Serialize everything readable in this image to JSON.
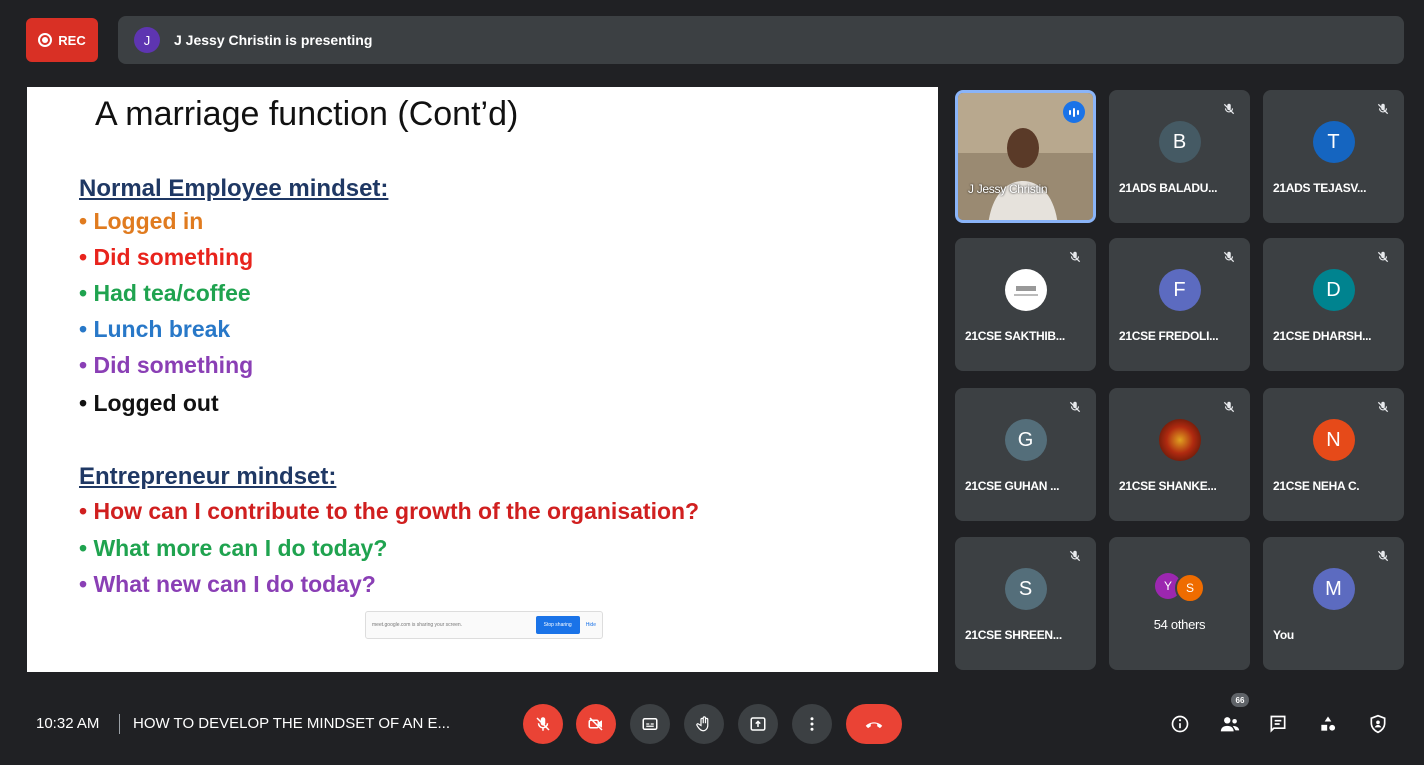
{
  "recording": {
    "label": "REC"
  },
  "presenter": {
    "initial": "J",
    "text": "J Jessy Christin is presenting"
  },
  "slide": {
    "title": "A marriage function (Cont’d)",
    "section1": {
      "heading": "Normal Employee mindset:",
      "items": [
        {
          "text": "Logged in",
          "color": "#e07b1f"
        },
        {
          "text": "Did something",
          "color": "#e8231c"
        },
        {
          "text": "Had tea/coffee",
          "color": "#1fa34f"
        },
        {
          "text": "Lunch break",
          "color": "#2878c8"
        },
        {
          "text": "Did something",
          "color": "#8a3fb5"
        },
        {
          "text": "Logged out",
          "color": "#111111"
        }
      ]
    },
    "section2": {
      "heading": "Entrepreneur mindset:",
      "items": [
        {
          "text": "How can I contribute to the growth of the organisation?",
          "color": "#d01f1f"
        },
        {
          "text": "What more can I do today?",
          "color": "#1fa34f"
        },
        {
          "text": "What new can I do today?",
          "color": "#8a3fb5"
        }
      ]
    },
    "share_bar": {
      "text": "meet.google.com is sharing your screen.",
      "stop_label": "Stop sharing",
      "hide_label": "Hide"
    }
  },
  "tiles": [
    {
      "name": "J Jessy Christin",
      "initial": "",
      "color": "",
      "type": "video"
    },
    {
      "name": "21ADS BALADU...",
      "initial": "B",
      "color": "#455a64"
    },
    {
      "name": "21ADS TEJASV...",
      "initial": "T",
      "color": "#1565c0"
    },
    {
      "name": "21CSE SAKTHIB...",
      "initial": "",
      "color": "#ffffff",
      "type": "logo"
    },
    {
      "name": "21CSE FREDOLI...",
      "initial": "F",
      "color": "#5c6bc0"
    },
    {
      "name": "21CSE DHARSH...",
      "initial": "D",
      "color": "#00838f"
    },
    {
      "name": "21CSE GUHAN ...",
      "initial": "G",
      "color": "#546e7a"
    },
    {
      "name": "21CSE SHANKE...",
      "initial": "",
      "color": "#8d2a10",
      "type": "photo"
    },
    {
      "name": "21CSE NEHA C.",
      "initial": "N",
      "color": "#e64a19"
    },
    {
      "name": "21CSE SHREEN...",
      "initial": "S",
      "color": "#546e7a"
    },
    {
      "name": "54 others",
      "initial": "",
      "color": "",
      "type": "others",
      "mini": [
        "Y",
        "S"
      ]
    },
    {
      "name": "You",
      "initial": "M",
      "color": "#5c6bc0"
    }
  ],
  "bottom": {
    "time": "10:32 AM",
    "meeting_title": "HOW TO DEVELOP THE MINDSET OF AN E...",
    "participants_count": "66"
  }
}
